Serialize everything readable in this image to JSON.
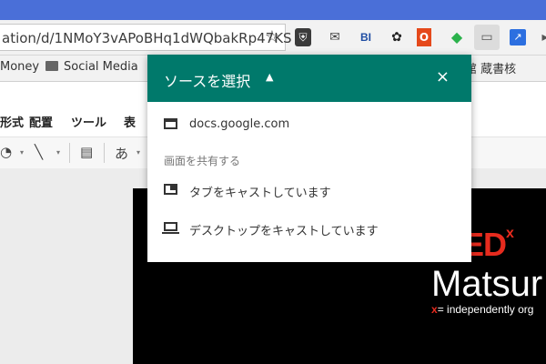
{
  "browser": {
    "url": "ation/d/1NMoY3vAPoBHq1dWQbakRp47KS",
    "star_icon": "star-icon",
    "extensions": [
      {
        "name": "shield-extension-icon",
        "glyph": "⛨"
      },
      {
        "name": "mail-extension-icon",
        "glyph": "✉"
      },
      {
        "name": "bi-extension-icon",
        "glyph": "BI"
      },
      {
        "name": "paint-extension-icon",
        "glyph": "✿"
      },
      {
        "name": "office-extension-icon",
        "glyph": "O"
      },
      {
        "name": "feedly-extension-icon",
        "glyph": "◆"
      },
      {
        "name": "cast-extension-icon",
        "glyph": "▭"
      },
      {
        "name": "chart-extension-icon",
        "glyph": "↗"
      }
    ]
  },
  "bookmarks": {
    "items": [
      "Money",
      "Social Media"
    ],
    "right_text": "書館 蔵書核"
  },
  "menu": {
    "items": [
      "形式",
      "配置",
      "ツール",
      "表"
    ]
  },
  "format_toolbar": {
    "text_item": "あ"
  },
  "slide": {
    "logo": "TEDx",
    "logo_main": "ED",
    "logo_x": "x",
    "city": "Matsur",
    "tagline_prefix": "x",
    "tagline": "= independently org"
  },
  "cast_dialog": {
    "title": "ソースを選択",
    "close_label": "×",
    "expand_glyph": "▲",
    "source": "docs.google.com",
    "section_heading": "画面を共有する",
    "options": [
      "タブをキャストしています",
      "デスクトップをキャストしています"
    ]
  },
  "colors": {
    "dialog_header": "#00796b",
    "chrome_top": "#4a6fd8",
    "ted_red": "#e62b1e"
  }
}
